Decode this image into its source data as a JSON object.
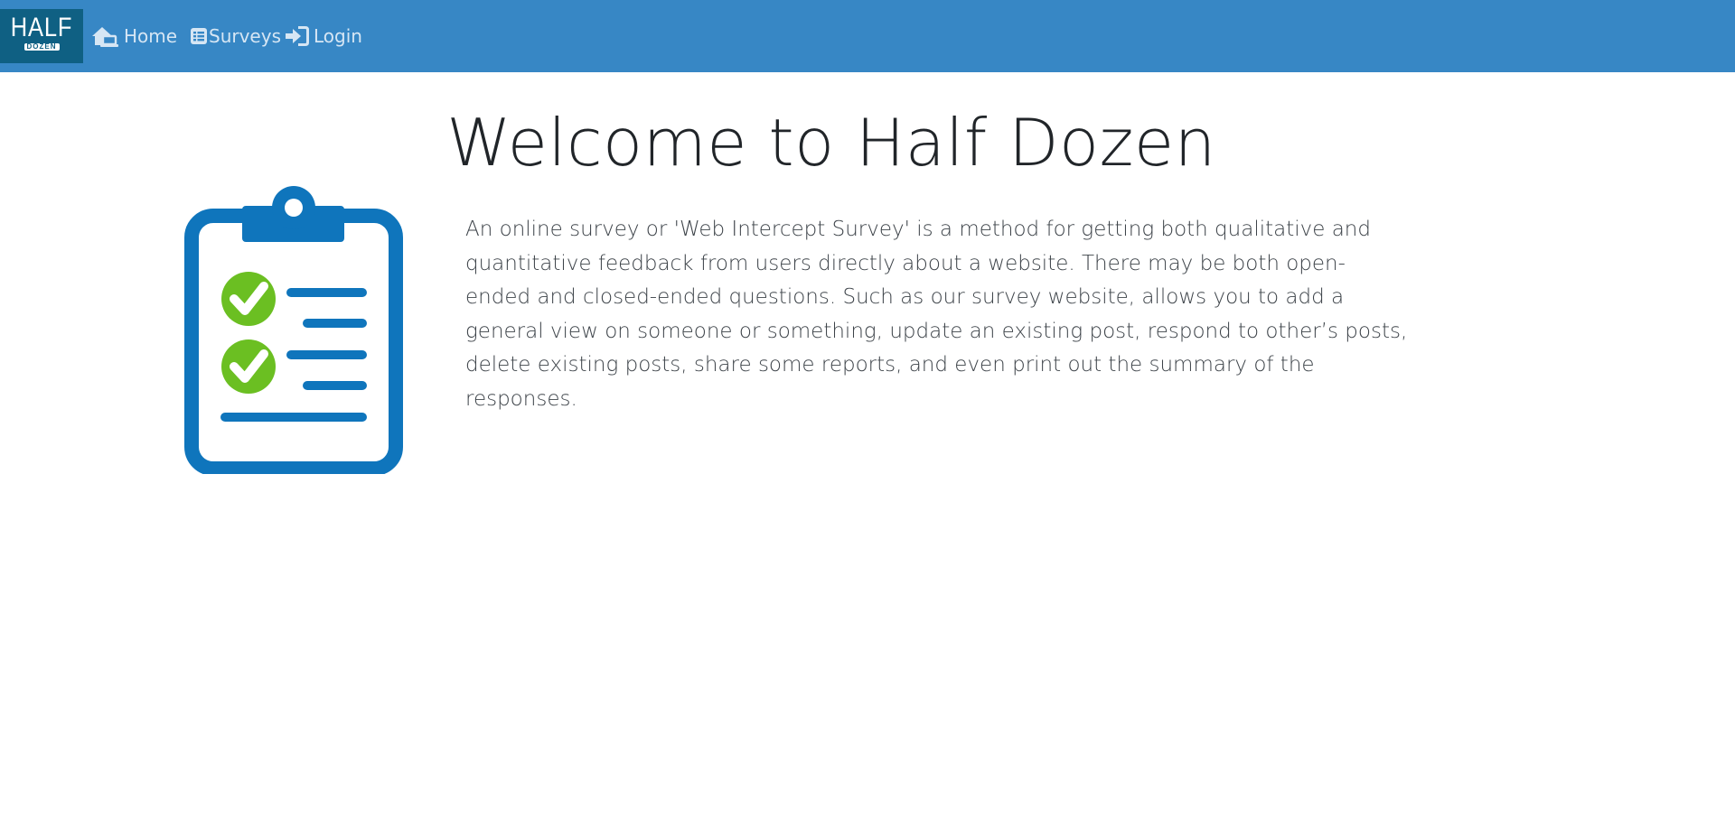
{
  "nav": {
    "logo_main": "HALF",
    "logo_sub": "DOZEN",
    "items": [
      {
        "label": "Home",
        "icon": "home-laptop-icon"
      },
      {
        "label": "Surveys",
        "icon": "list-alt-icon"
      },
      {
        "label": "Login",
        "icon": "sign-in-icon"
      }
    ]
  },
  "main": {
    "title": "Welcome to Half Dozen",
    "illustration": "clipboard-checklist-icon",
    "intro": "An online survey or 'Web Intercept Survey' is a method for getting both qualitative and quantitative feedback from users directly about a website. There may be both open-ended and closed-ended questions. Such as our survey website, allows you to add a general view on someone or something, update an existing post, respond to other’s posts, delete existing posts, share some reports, and even print out the summary of the responses."
  },
  "colors": {
    "navbar": "#3787c5",
    "logo_bg": "#0f6083",
    "clipboard_blue": "#0f75bc",
    "check_green": "#6bbf22"
  }
}
